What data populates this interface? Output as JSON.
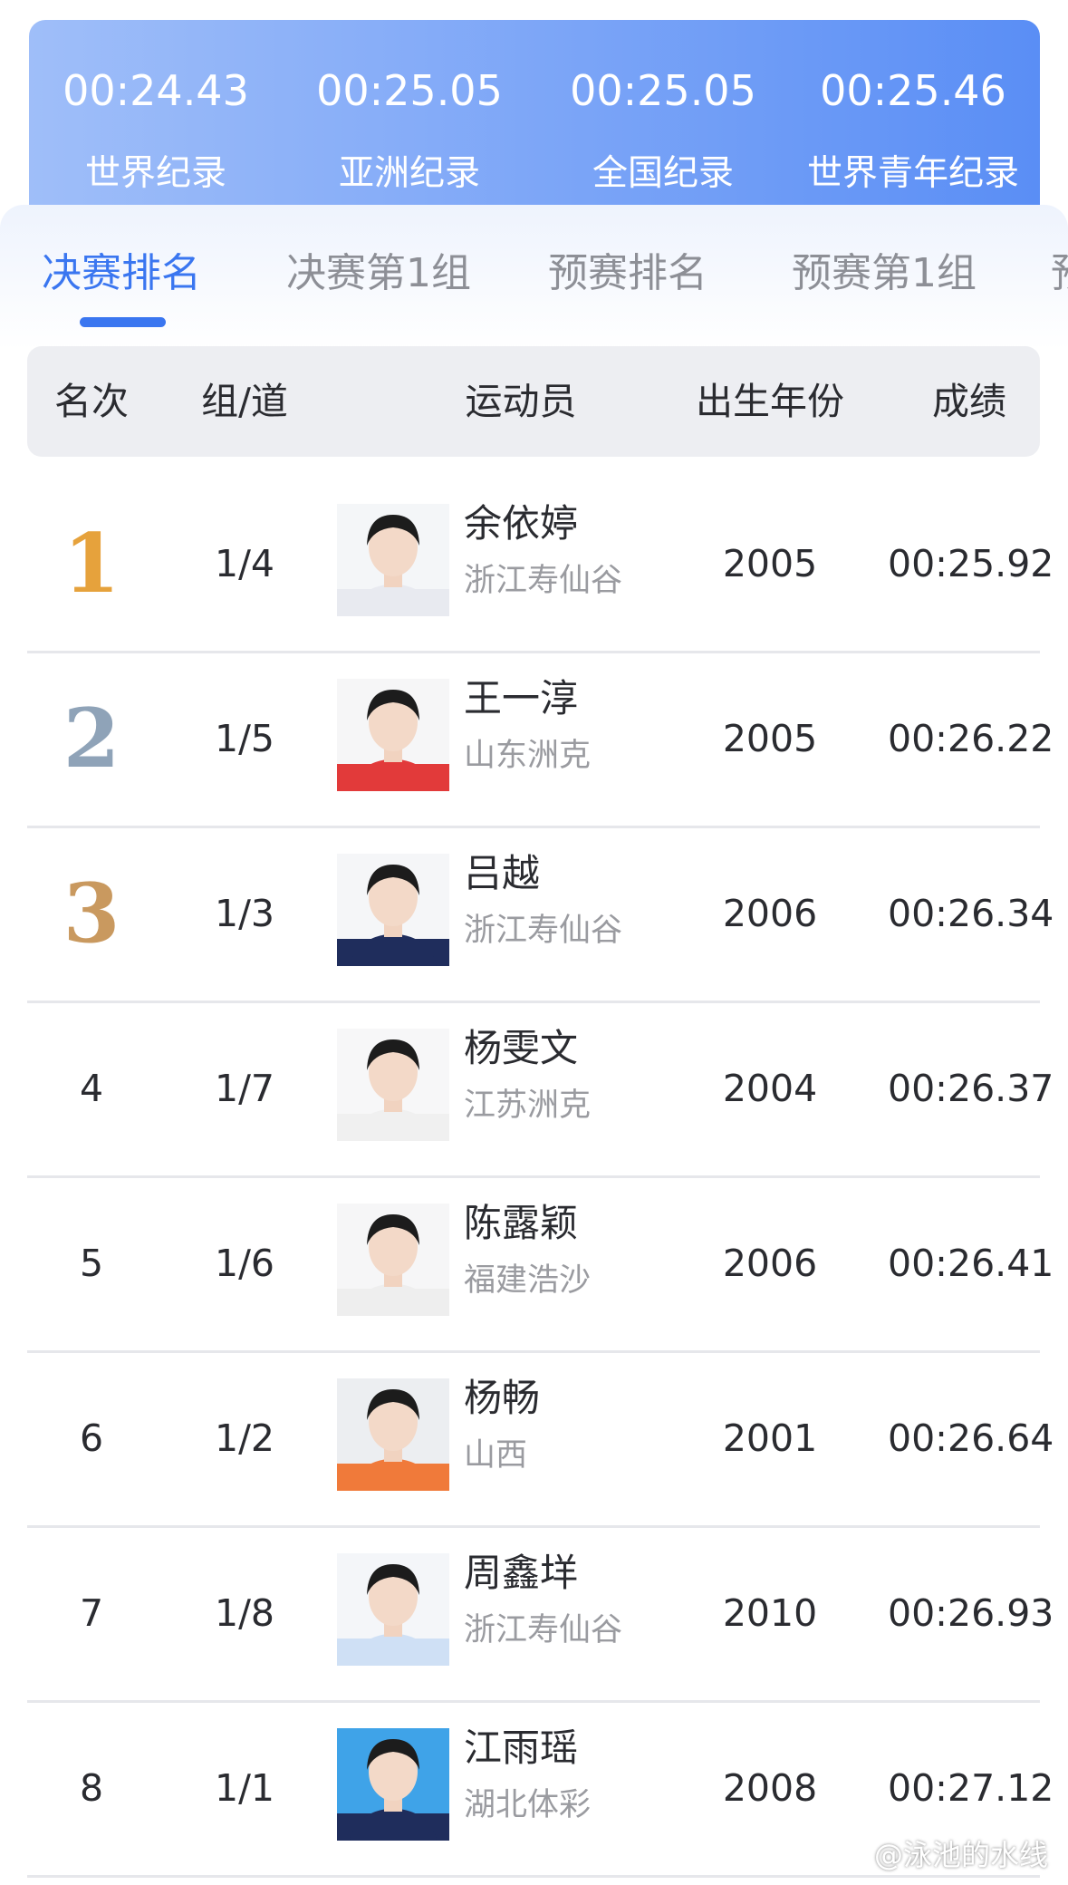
{
  "records": [
    {
      "time": "00:24.43",
      "label": "世界纪录"
    },
    {
      "time": "00:25.05",
      "label": "亚洲纪录"
    },
    {
      "time": "00:25.05",
      "label": "全国纪录"
    },
    {
      "time": "00:25.46",
      "label": "世界青年纪录"
    }
  ],
  "tabs": [
    "决赛排名",
    "决赛第1组",
    "预赛排名",
    "预赛第1组",
    "预"
  ],
  "active_tab": 0,
  "table": {
    "headers": {
      "rank": "名次",
      "lane": "组/道",
      "athlete": "运动员",
      "birth_year": "出生年份",
      "result": "成绩"
    },
    "rows": [
      {
        "rank": "1",
        "medal": "gold-medal-number-icon",
        "lane": "1/4",
        "name": "余依婷",
        "team": "浙江寿仙谷",
        "birth_year": "2005",
        "result": "00:25.92",
        "photo_bg": "#f4f6f8",
        "shirt": "#e8eaf0"
      },
      {
        "rank": "2",
        "medal": "silver-medal-number-icon",
        "lane": "1/5",
        "name": "王一淳",
        "team": "山东洲克",
        "birth_year": "2005",
        "result": "00:26.22",
        "photo_bg": "#f6f6f7",
        "shirt": "#e23a3a"
      },
      {
        "rank": "3",
        "medal": "bronze-medal-number-icon",
        "lane": "1/3",
        "name": "吕越",
        "team": "浙江寿仙谷",
        "birth_year": "2006",
        "result": "00:26.34",
        "photo_bg": "#f5f6f8",
        "shirt": "#1f2d5c"
      },
      {
        "rank": "4",
        "medal": "",
        "lane": "1/7",
        "name": "杨雯文",
        "team": "江苏洲克",
        "birth_year": "2004",
        "result": "00:26.37",
        "photo_bg": "#f7f7f8",
        "shirt": "#f0f0f0"
      },
      {
        "rank": "5",
        "medal": "",
        "lane": "1/6",
        "name": "陈露颖",
        "team": "福建浩沙",
        "birth_year": "2006",
        "result": "00:26.41",
        "photo_bg": "#f6f6f7",
        "shirt": "#eeeeee"
      },
      {
        "rank": "6",
        "medal": "",
        "lane": "1/2",
        "name": "杨畅",
        "team": "山西",
        "birth_year": "2001",
        "result": "00:26.64",
        "photo_bg": "#eceef1",
        "shirt": "#f07a3a"
      },
      {
        "rank": "7",
        "medal": "",
        "lane": "1/8",
        "name": "周鑫垟",
        "team": "浙江寿仙谷",
        "birth_year": "2010",
        "result": "00:26.93",
        "photo_bg": "#f4f6f9",
        "shirt": "#cfe0f5"
      },
      {
        "rank": "8",
        "medal": "",
        "lane": "1/1",
        "name": "江雨瑶",
        "team": "湖北体彩",
        "birth_year": "2008",
        "result": "00:27.12",
        "photo_bg": "#3fa3e8",
        "shirt": "#1f2d5c"
      }
    ]
  },
  "colors": {
    "accent": "#3a76f0",
    "gold": "#e6a23c",
    "silver": "#8fa3b8",
    "bronze": "#c9995f",
    "record_gradient_start": "#9fbef9",
    "record_gradient_end": "#5a8ef5"
  },
  "watermark": "@泳池的水线"
}
